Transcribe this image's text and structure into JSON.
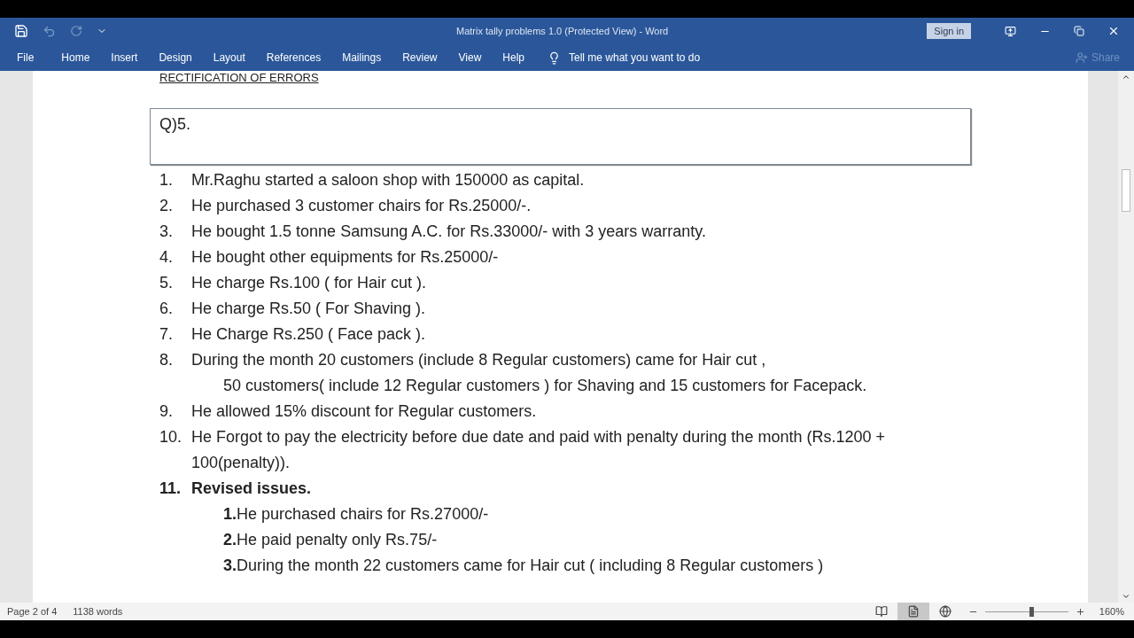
{
  "window": {
    "title": "Matrix tally problems 1.0 (Protected View)  -  Word",
    "sign_in": "Sign in"
  },
  "ribbon_tabs": [
    {
      "label": "File",
      "selected": false
    },
    {
      "label": "Home",
      "selected": false
    },
    {
      "label": "Insert",
      "selected": false
    },
    {
      "label": "Design",
      "selected": false
    },
    {
      "label": "Layout",
      "selected": false
    },
    {
      "label": "References",
      "selected": false
    },
    {
      "label": "Mailings",
      "selected": false
    },
    {
      "label": "Review",
      "selected": false
    },
    {
      "label": "View",
      "selected": false
    },
    {
      "label": "Help",
      "selected": false
    }
  ],
  "tell_me": "Tell me what you want to do",
  "share": "Share",
  "document": {
    "heading": "RECTIFICATION OF ERRORS",
    "question": "Q)5.",
    "items": [
      {
        "number": "1.",
        "text": "Mr.Raghu started a saloon shop with 150000 as capital.",
        "bold": false
      },
      {
        "number": "2.",
        "text": "He purchased 3 customer chairs for Rs.25000/-.",
        "bold": false
      },
      {
        "number": "3.",
        "text": "He bought 1.5 tonne  Samsung A.C. for Rs.33000/- with 3 years warranty.",
        "bold": false
      },
      {
        "number": "4.",
        "text": "He bought other equipments for Rs.25000/-",
        "bold": false
      },
      {
        "number": "5.",
        "text": "He charge Rs.100 ( for Hair cut ).",
        "bold": false
      },
      {
        "number": "6.",
        "text": "He charge Rs.50 ( For Shaving ).",
        "bold": false
      },
      {
        "number": "7.",
        "text": "He Charge Rs.250 ( Face pack ).",
        "bold": false
      },
      {
        "number": "8.",
        "text": "During the month 20 customers (include 8 Regular customers) came for Hair cut ,",
        "bold": false,
        "continuation": "50 customers( include 12 Regular customers ) for Shaving and 15 customers for Facepack."
      },
      {
        "number": "9.",
        "text": "He allowed 15% discount for Regular customers.",
        "bold": false
      },
      {
        "number": "10.",
        "text": "He Forgot to pay the electricity before due date and paid with penalty during the month (Rs.1200 + 100(penalty)).",
        "bold": false
      },
      {
        "number": "11.",
        "text": "Revised issues.",
        "bold": true,
        "children": [
          {
            "text": "**1.**He purchased chairs for Rs.27000/-"
          },
          {
            "text": "**2.**He paid penalty only Rs.75/-"
          },
          {
            "text": "**3.**During the month 22 customers came for Hair cut ( including 8 Regular customers )"
          }
        ]
      }
    ]
  },
  "status_bar": {
    "page": "Page 2 of 4",
    "words": "1138 words",
    "views": [
      {
        "kind": "read",
        "selected": false
      },
      {
        "kind": "print",
        "selected": true
      },
      {
        "kind": "web",
        "selected": false
      }
    ],
    "zoom": {
      "level": 0.56,
      "reading": "160%"
    }
  }
}
